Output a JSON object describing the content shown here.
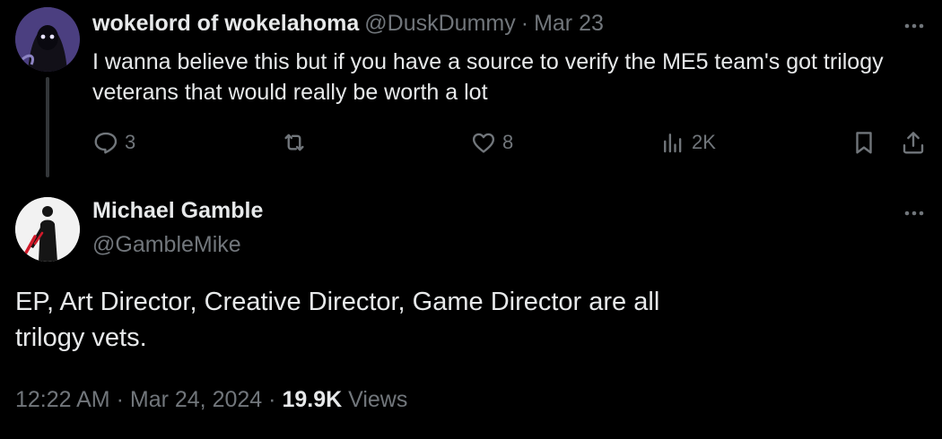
{
  "reply_tweet": {
    "display_name": "wokelord of wokelahoma",
    "handle": "@DuskDummy",
    "separator": "·",
    "date": "Mar 23",
    "text": "I wanna believe this but if you have a source to verify the ME5 team's got trilogy veterans that would really be worth a lot",
    "replies_count": "3",
    "likes_count": "8",
    "views_count": "2K",
    "icons": [
      "reply-icon",
      "retweet-icon",
      "like-icon",
      "views-icon",
      "bookmark-icon",
      "share-icon",
      "more-icon"
    ]
  },
  "main_tweet": {
    "display_name": "Michael Gamble",
    "handle": "@GambleMike",
    "text": "EP, Art Director, Creative Director, Game Director are all trilogy vets.",
    "time": "12:22 AM",
    "separator": "·",
    "date": "Mar 24, 2024",
    "views_count": "19.9K",
    "views_label": "Views"
  },
  "colors": {
    "background": "#000000",
    "text_primary": "#e7e9ea",
    "text_muted": "#71767b",
    "thread_line": "#333639"
  }
}
